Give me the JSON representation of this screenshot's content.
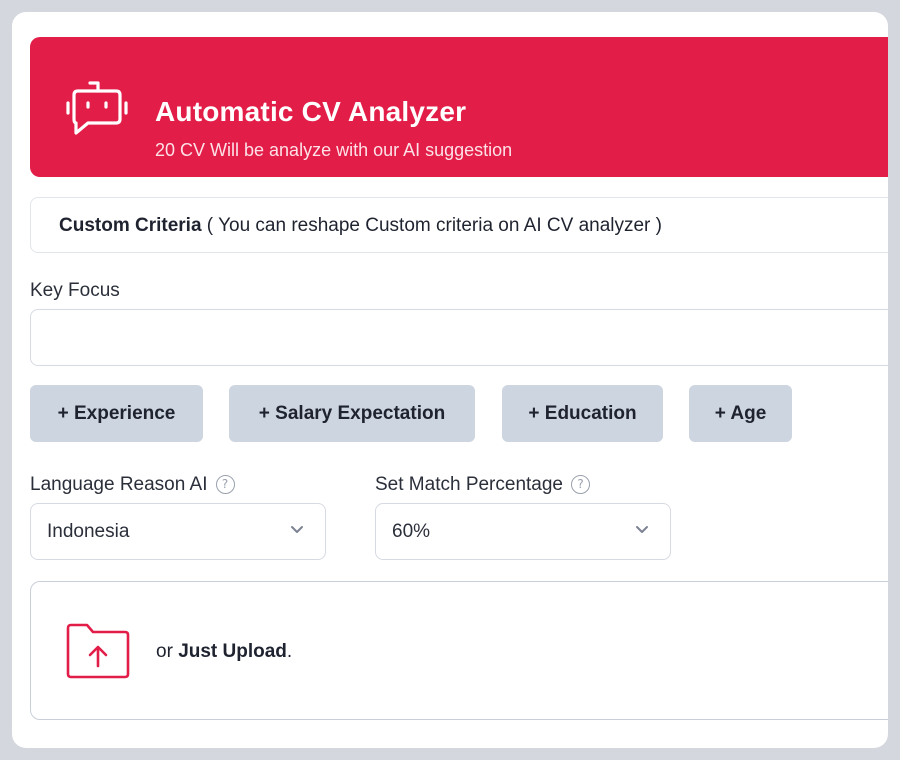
{
  "hero": {
    "title": "Automatic CV Analyzer",
    "subtitle": "20 CV Will be analyze with our AI suggestion",
    "icon": "chat-bot-icon"
  },
  "criteria": {
    "title": "Custom Criteria",
    "note": " ( You can reshape Custom criteria on AI  CV analyzer )"
  },
  "key_focus": {
    "label": "Key Focus",
    "value": "",
    "chips": [
      "+ Experience",
      "+ Salary Expectation",
      "+ Education",
      "+ Age"
    ]
  },
  "language": {
    "label": "Language Reason AI",
    "help_glyph": "?",
    "value": "Indonesia"
  },
  "match": {
    "label": "Set Match Percentage",
    "help_glyph": "?",
    "value": "60%"
  },
  "upload": {
    "prefix": "or ",
    "strong": "Just Upload",
    "suffix": ".",
    "icon": "folder-upload-icon"
  },
  "colors": {
    "accent": "#e21d48",
    "chip_bg": "#cdd5e0",
    "border": "#d6dae2"
  }
}
